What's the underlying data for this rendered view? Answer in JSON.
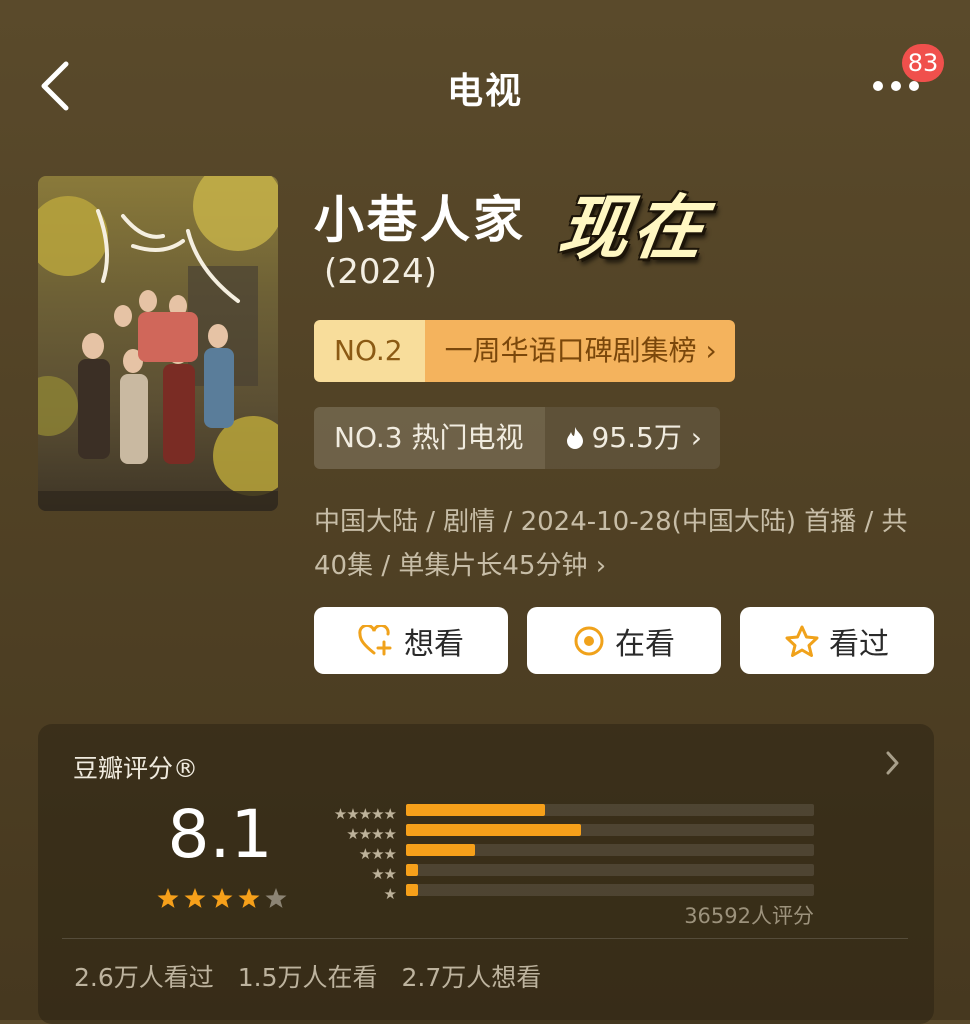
{
  "header": {
    "title": "电视",
    "notification_count": "83",
    "back_icon": "chevron-left-icon",
    "more_icon": "more-dots-icon"
  },
  "show": {
    "title": "小巷人家",
    "overlay_text": "现在",
    "year": "(2024)"
  },
  "rankings": [
    {
      "rank": "NO.2",
      "name": "一周华语口碑剧集榜 ›"
    },
    {
      "rank": "NO.3 热门电视",
      "heat": "95.5万 ›"
    }
  ],
  "meta": {
    "line1": "中国大陆 / 剧情 / 2024-10-28(中国大陆) 首播 / 共",
    "line2": "40集 / 单集片长45分钟 ›"
  },
  "actions": {
    "want": "想看",
    "watching": "在看",
    "watched": "看过"
  },
  "rating": {
    "label": "豆瓣评分®",
    "score": "8.1",
    "star_level": 4,
    "count": "36592人评分",
    "distribution": [
      0.34,
      0.43,
      0.17,
      0.03,
      0.03
    ]
  },
  "stats": {
    "watched": "2.6万人看过",
    "watching": "1.5万人在看",
    "want": "2.7万人想看"
  },
  "colors": {
    "accent": "#f6a01a",
    "badge": "#f0504c",
    "rank_gold_light": "#f8dd9b",
    "rank_gold": "#f4b35d"
  }
}
